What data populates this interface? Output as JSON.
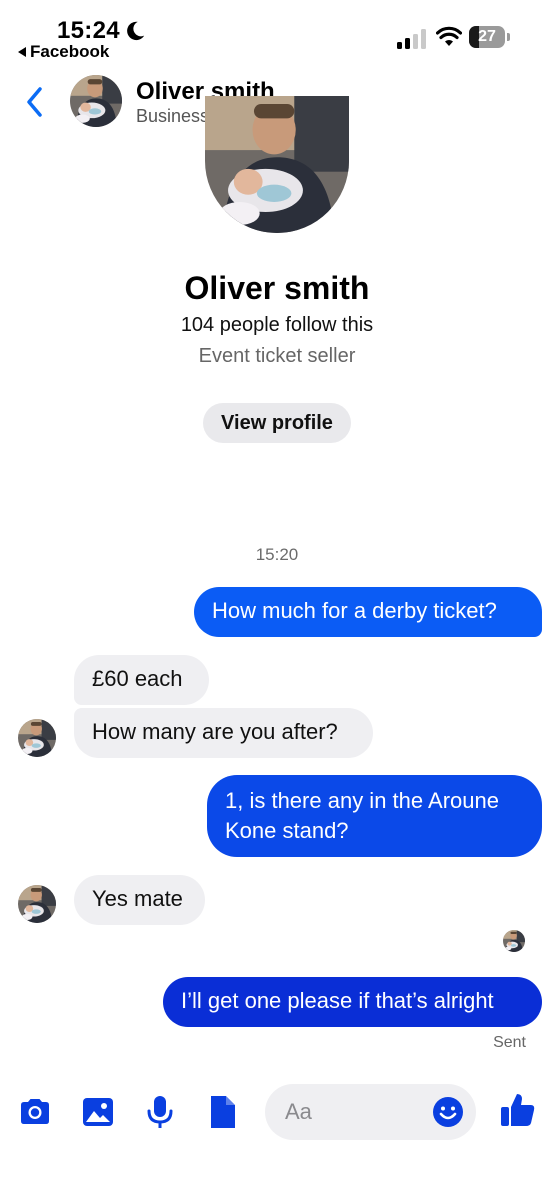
{
  "status_bar": {
    "time": "15:24",
    "back_app_label": "Facebook",
    "battery_level": "27",
    "battery_fraction": 0.27,
    "icons": [
      "moon-icon",
      "signal-icon",
      "wifi-icon",
      "battery-icon"
    ]
  },
  "header": {
    "name": "Oliver smith",
    "subtitle": "Business chat"
  },
  "profile": {
    "name": "Oliver smith",
    "followers": "104 people follow this",
    "description": "Event ticket seller",
    "button_label": "View profile"
  },
  "thread": {
    "timestamp": "15:20",
    "messages": [
      {
        "direction": "outgoing",
        "text": "How much for a derby ticket?"
      },
      {
        "direction": "incoming",
        "text": "£60 each"
      },
      {
        "direction": "incoming",
        "text": "How many are you after?"
      },
      {
        "direction": "outgoing",
        "text": "1, is there any in the Aroune Kone stand?"
      },
      {
        "direction": "incoming",
        "text": "Yes mate"
      },
      {
        "direction": "outgoing",
        "text": "I’ll get one please if that’s alright"
      }
    ],
    "sent_label": "Sent"
  },
  "composer": {
    "placeholder": "Aa",
    "tools": [
      "camera-icon",
      "gallery-icon",
      "microphone-icon",
      "document-icon",
      "emoji-icon",
      "thumbs-up-icon"
    ]
  },
  "colors": {
    "accent": "#0b5cf5",
    "outgoing_bubble": "#0b5cf5",
    "incoming_bubble": "#efeff2"
  }
}
